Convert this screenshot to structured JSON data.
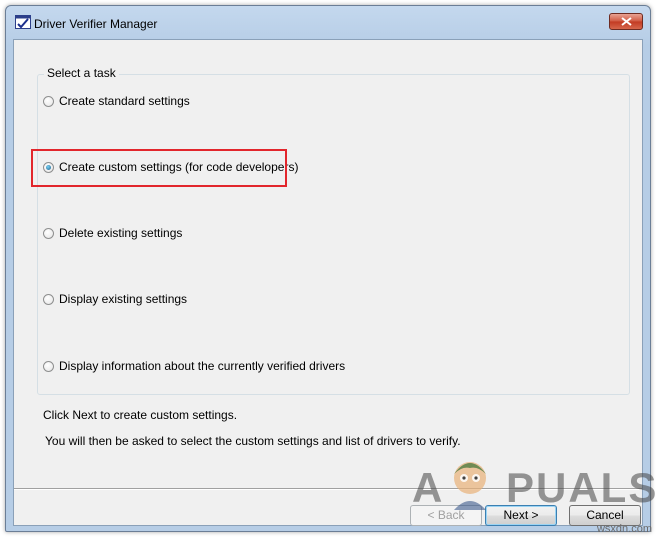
{
  "window": {
    "title": "Driver Verifier Manager"
  },
  "group": {
    "label": "Select a task",
    "options": [
      {
        "label": "Create standard settings",
        "checked": false
      },
      {
        "label": "Create custom settings (for code developers)",
        "checked": true
      },
      {
        "label": "Delete existing settings",
        "checked": false
      },
      {
        "label": "Display existing settings",
        "checked": false
      },
      {
        "label": "Display information about the currently verified drivers",
        "checked": false
      }
    ]
  },
  "info": {
    "line1": "Click Next to create custom settings.",
    "line2": "You will then be asked to select the custom settings and list of drivers to verify."
  },
  "buttons": {
    "back": "< Back",
    "next": "Next >",
    "cancel": "Cancel"
  },
  "watermark": {
    "logo_a": "A",
    "logo_rest": "PUALS",
    "site": "wsxdn.com"
  },
  "colors": {
    "highlight": "#e2262c",
    "titlebar": "#c4d8ee",
    "client_bg": "#f0f0f0"
  },
  "icons": {
    "app": "driver-verifier-icon",
    "close": "close-x-icon"
  }
}
